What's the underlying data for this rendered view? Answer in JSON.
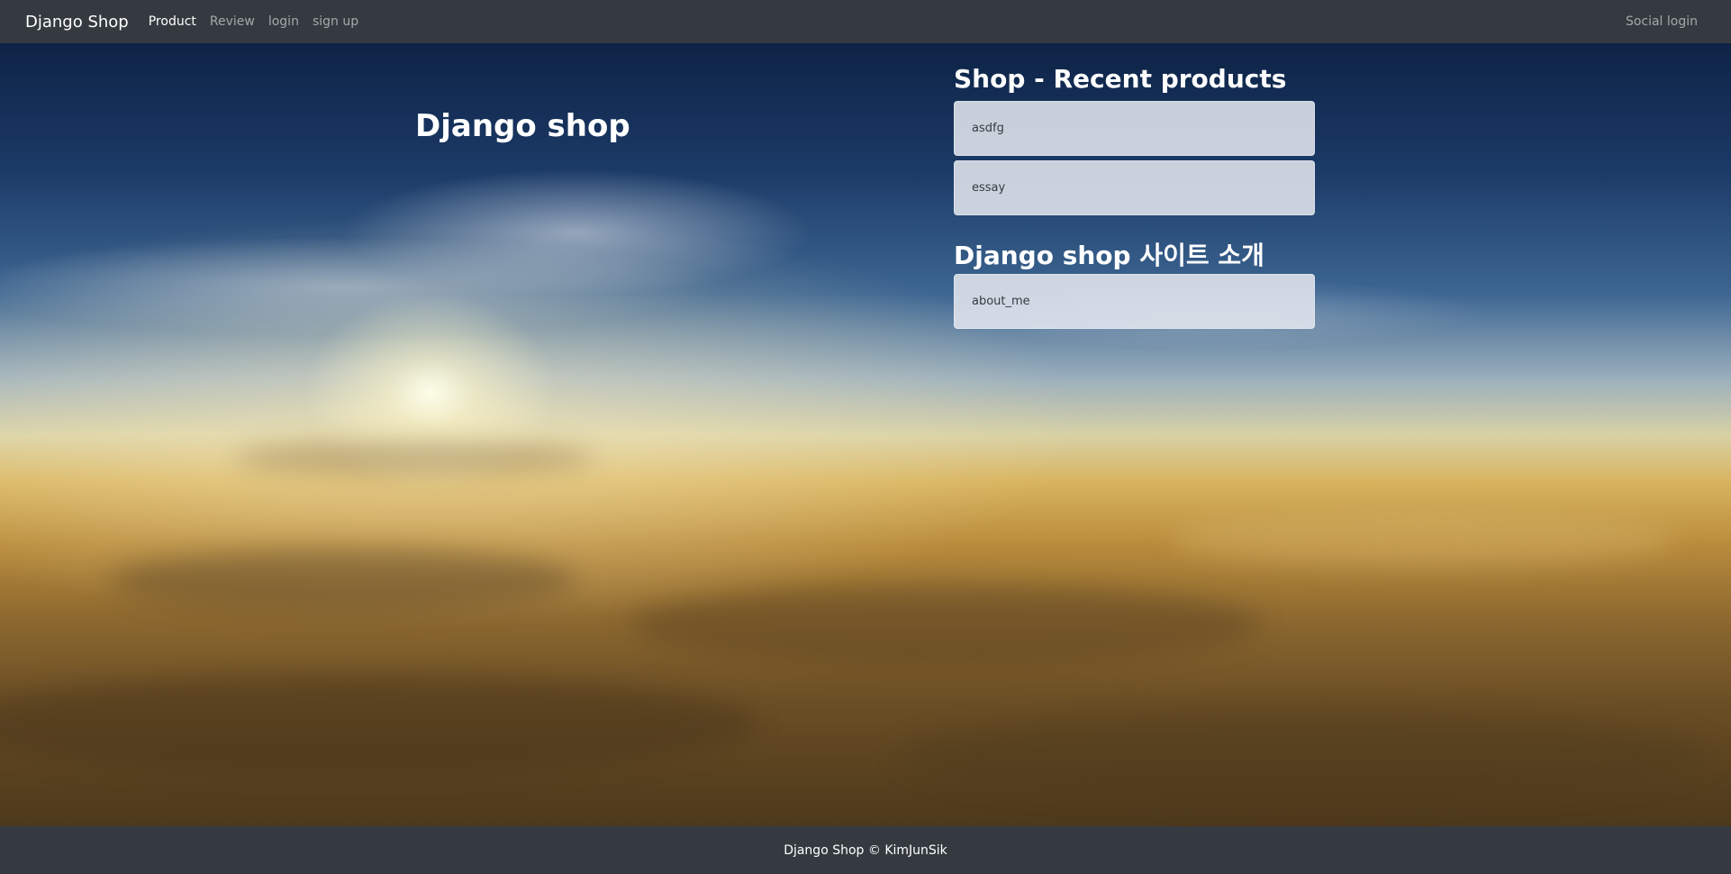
{
  "navbar": {
    "brand": "Django Shop",
    "links": [
      {
        "label": "Product",
        "active": true
      },
      {
        "label": "Review",
        "active": false
      },
      {
        "label": "login",
        "active": false
      },
      {
        "label": "sign up",
        "active": false
      }
    ],
    "right_link": "Social login"
  },
  "main": {
    "title": "Django shop",
    "recent_title": "Shop - Recent products",
    "recent_items": [
      "asdfg",
      "essay"
    ],
    "about_title": "Django shop 사이트 소개",
    "about_items": [
      "about_me"
    ]
  },
  "footer": {
    "text": "Django Shop © KimJunSik"
  },
  "colors": {
    "navbar_bg": "#343a40",
    "card_bg": "#e2e6ee",
    "text_light": "#ffffff"
  }
}
